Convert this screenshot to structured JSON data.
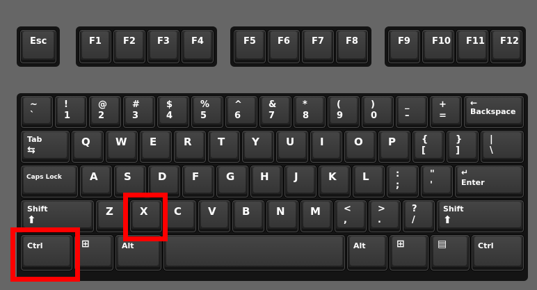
{
  "keyboard": {
    "function_row": {
      "esc": "Esc",
      "f_keys": [
        "F1",
        "F2",
        "F3",
        "F4",
        "F5",
        "F6",
        "F7",
        "F8",
        "F9",
        "F10",
        "F11",
        "F12"
      ]
    },
    "number_row": {
      "pairs": [
        {
          "top": "~",
          "bottom": "`"
        },
        {
          "top": "!",
          "bottom": "1"
        },
        {
          "top": "@",
          "bottom": "2"
        },
        {
          "top": "#",
          "bottom": "3"
        },
        {
          "top": "$",
          "bottom": "4"
        },
        {
          "top": "%",
          "bottom": "5"
        },
        {
          "top": "^",
          "bottom": "6"
        },
        {
          "top": "&",
          "bottom": "7"
        },
        {
          "top": "*",
          "bottom": "8"
        },
        {
          "top": "(",
          "bottom": "9"
        },
        {
          "top": ")",
          "bottom": "0"
        },
        {
          "top": "_",
          "bottom": "–"
        },
        {
          "top": "+",
          "bottom": "="
        }
      ],
      "backspace_arrow": "←",
      "backspace": "Backspace"
    },
    "qwerty_row": {
      "tab": "Tab",
      "tab_symbol": "⇆",
      "letters": [
        "Q",
        "W",
        "E",
        "R",
        "T",
        "Y",
        "U",
        "I",
        "O",
        "P"
      ],
      "brackets": [
        {
          "top": "{",
          "bottom": "["
        },
        {
          "top": "}",
          "bottom": "]"
        },
        {
          "top": "|",
          "bottom": "\\"
        }
      ]
    },
    "home_row": {
      "caps_lock": "Caps Lock",
      "letters": [
        "A",
        "S",
        "D",
        "F",
        "G",
        "H",
        "J",
        "K",
        "L"
      ],
      "punct": [
        {
          "top": ":",
          "bottom": ";"
        },
        {
          "top": "\"",
          "bottom": "'"
        }
      ],
      "enter_arrow": "↵",
      "enter": "Enter"
    },
    "bottom_row": {
      "shift": "Shift",
      "shift_arrow": "⬆",
      "letters": [
        "Z",
        "X",
        "C",
        "V",
        "B",
        "N",
        "M"
      ],
      "punct": [
        {
          "top": "<",
          "bottom": ","
        },
        {
          "top": ">",
          "bottom": "."
        },
        {
          "top": "?",
          "bottom": "/"
        }
      ]
    },
    "space_row": {
      "ctrl": "Ctrl",
      "alt": "Alt",
      "win_icon": "windows-icon",
      "menu_icon": "menu-icon",
      "win_glyph": "⊞",
      "menu_glyph": "▤"
    },
    "highlight_color": "#ff0000"
  }
}
